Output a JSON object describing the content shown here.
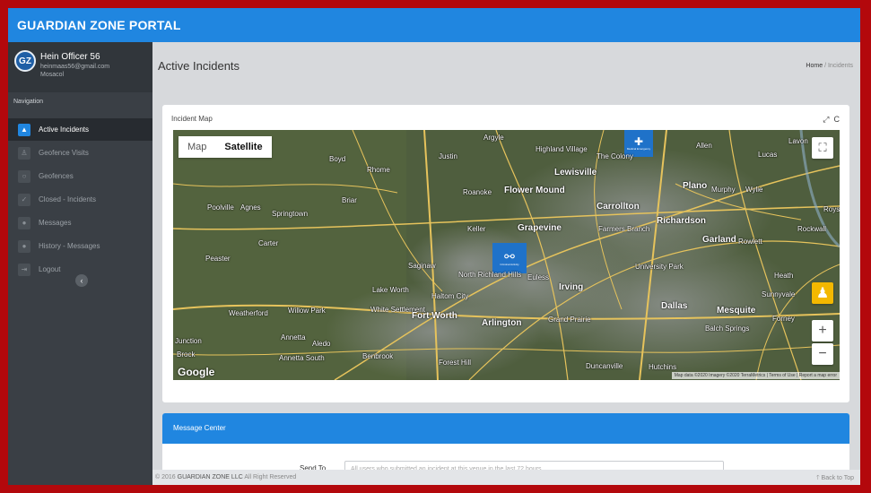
{
  "app": {
    "title": "GUARDIAN ZONE PORTAL"
  },
  "user": {
    "initials": "GZ",
    "name": "Hein Officer 56",
    "email": "heinmaas56@gmail.com",
    "location": "Mosacol"
  },
  "sidebar": {
    "nav_label": "Navigation",
    "items": [
      {
        "label": "Active Incidents",
        "icon": "warning-icon"
      },
      {
        "label": "Geofence Visits",
        "icon": "person-icon"
      },
      {
        "label": "Geofences",
        "icon": "circle-icon"
      },
      {
        "label": "Closed - Incidents",
        "icon": "check-icon"
      },
      {
        "label": "Messages",
        "icon": "chat-icon"
      },
      {
        "label": "History - Messages",
        "icon": "chat-icon"
      },
      {
        "label": "Logout",
        "icon": "logout-icon"
      }
    ],
    "collapse_glyph": "‹"
  },
  "page": {
    "title": "Active Incidents",
    "breadcrumb": {
      "home": "Home",
      "separator": "/",
      "current": "Incidents"
    }
  },
  "map_card": {
    "title": "Incident Map",
    "tools": {
      "expand": "⤢",
      "refresh": "C"
    },
    "map_type": {
      "map": "Map",
      "satellite": "Satellite"
    },
    "zoom_in": "+",
    "zoom_out": "−",
    "fullscreen_glyph": "⛶",
    "pegman_glyph": "♟",
    "google": "Google",
    "attribution": "Map data ©2020 Imagery ©2020 TerraMetrics | Terms of Use | Report a map error",
    "markers": [
      {
        "glyph": "✚",
        "label": "Medical Emergency"
      },
      {
        "glyph": "⚯",
        "label": "Criminal Activity"
      }
    ],
    "places": [
      "Argyle",
      "Highland Village",
      "The Colony",
      "Allen",
      "Lucas",
      "Lavon",
      "Justin",
      "Lewisville",
      "Plano",
      "Murphy",
      "Wylie",
      "Boyd",
      "Rhome",
      "Roanoke",
      "Flower Mound",
      "Carrollton",
      "Richardson",
      "Royse",
      "Briar",
      "Poolville",
      "Agnes",
      "Springtown",
      "Keller",
      "Grapevine",
      "Farmers Branch",
      "Garland",
      "Rowlett",
      "Rockwall",
      "Carter",
      "Peaster",
      "Saginaw",
      "North Richland Hills",
      "Euless",
      "Irving",
      "University Park",
      "Heath",
      "Lake Worth",
      "Haltom City",
      "Sunnyvale",
      "Weatherford",
      "Willow Park",
      "White Settlement",
      "Fort Worth",
      "Arlington",
      "Grand Prairie",
      "Dallas",
      "Mesquite",
      "Forney",
      "Annetta",
      "Aledo",
      "Balch Springs",
      "Junction",
      "Brock",
      "Annetta South",
      "Benbrook",
      "Forest Hill",
      "Duncanville",
      "Hutchins"
    ]
  },
  "message_center": {
    "title": "Message Center",
    "send_to_label": "Send To",
    "send_to_placeholder": "All users who submitted an incident at this venue in the last 72 hours"
  },
  "footer": {
    "copyright_prefix": "© 2016",
    "company": "GUARDIAN ZONE LLC",
    "copyright_suffix": "All Right Reserved",
    "back_to_top": "Back to Top",
    "back_arrow": "🡑"
  },
  "colors": {
    "primary": "#2086e0",
    "frame": "#b3080c",
    "sidebar": "#3a3f45",
    "sidebar_active": "#272b30"
  }
}
